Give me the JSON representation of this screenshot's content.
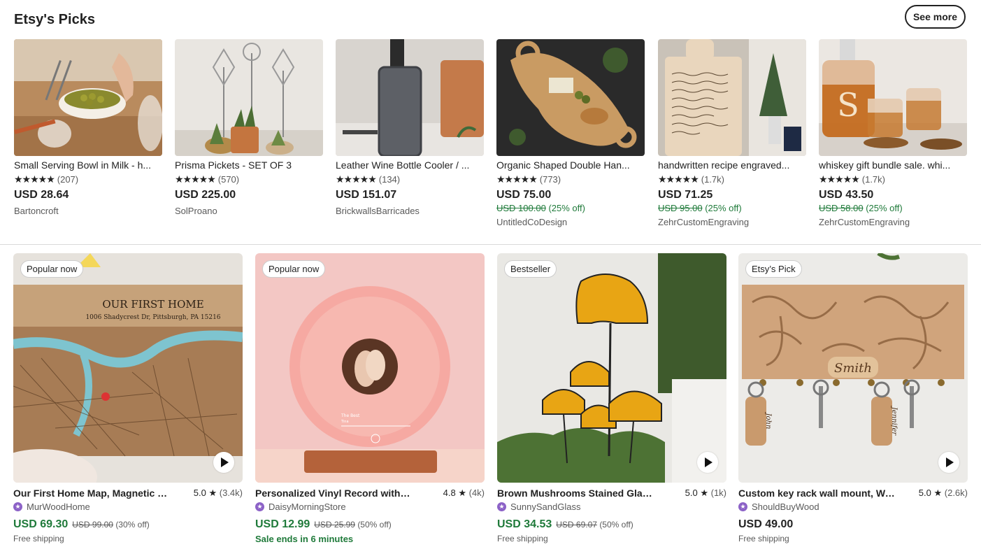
{
  "header": {
    "title": "Etsy's Picks",
    "see_more": "See more"
  },
  "picks": [
    {
      "title": "Small Serving Bowl in Milk - h...",
      "stars": "★★★★★",
      "rating_count": "(207)",
      "price": "USD 28.64",
      "orig_price": "",
      "discount": "",
      "shop": "Bartoncroft"
    },
    {
      "title": "Prisma Pickets - SET OF 3",
      "stars": "★★★★★",
      "rating_count": "(570)",
      "price": "USD 225.00",
      "orig_price": "",
      "discount": "",
      "shop": "SolProano"
    },
    {
      "title": "Leather Wine Bottle Cooler / ...",
      "stars": "★★★★★",
      "rating_count": "(134)",
      "price": "USD 151.07",
      "orig_price": "",
      "discount": "",
      "shop": "BrickwallsBarricades"
    },
    {
      "title": "Organic Shaped Double Han...",
      "stars": "★★★★★",
      "rating_count": "(773)",
      "price": "USD 75.00",
      "orig_price": "USD 100.00",
      "discount": "(25% off)",
      "shop": "UntitledCoDesign"
    },
    {
      "title": "handwritten recipe engraved...",
      "stars": "★★★★★",
      "rating_count": "(1.7k)",
      "price": "USD 71.25",
      "orig_price": "USD 95.00",
      "discount": "(25% off)",
      "shop": "ZehrCustomEngraving"
    },
    {
      "title": "whiskey gift bundle sale. whi...",
      "stars": "★★★★★",
      "rating_count": "(1.7k)",
      "price": "USD 43.50",
      "orig_price": "USD 58.00",
      "discount": "(25% off)",
      "shop": "ZehrCustomEngraving"
    }
  ],
  "featured": [
    {
      "badge": "Popular now",
      "title": "Our First Home Map, Magnetic K...",
      "rating": "5.0",
      "star": "★",
      "count": "(3.4k)",
      "shop": "MurWoodHome",
      "price": "USD 69.30",
      "orig_price": "USD 99.00",
      "discount": "(30% off)",
      "note": "Free shipping",
      "price_green": true,
      "note_green": false
    },
    {
      "badge": "Popular now",
      "title": "Personalized Vinyl Record with P...",
      "rating": "4.8",
      "star": "★",
      "count": "(4k)",
      "shop": "DaisyMorningStore",
      "price": "USD 12.99",
      "orig_price": "USD 25.99",
      "discount": "(50% off)",
      "note": "Sale ends in 6 minutes",
      "price_green": true,
      "note_green": true
    },
    {
      "badge": "Bestseller",
      "title": "Brown Mushrooms Stained Glas...",
      "rating": "5.0",
      "star": "★",
      "count": "(1k)",
      "shop": "SunnySandGlass",
      "price": "USD 34.53",
      "orig_price": "USD 69.07",
      "discount": "(50% off)",
      "note": "Free shipping",
      "price_green": true,
      "note_green": false
    },
    {
      "badge": "Etsy’s Pick",
      "title": "Custom key rack wall mount, Wo...",
      "rating": "5.0",
      "star": "★",
      "count": "(2.6k)",
      "shop": "ShouldBuyWood",
      "price": "USD 49.00",
      "orig_price": "",
      "discount": "",
      "note": "Free shipping",
      "price_green": false,
      "note_green": false
    }
  ],
  "featured_texts": {
    "map_title": "OUR FIRST HOME",
    "map_address": "1006 Shadycrest Dr, Pittsburgh, PA 15216",
    "record_song": "The Best",
    "record_artist": "Tina",
    "keyrack_name": "Smith",
    "key_tag_1": "John",
    "key_tag_2": "Jennifer"
  },
  "colors": {
    "green": "#1f7a3a",
    "star_seller": "#8c62c7",
    "text": "#222222",
    "muted": "#595959"
  }
}
